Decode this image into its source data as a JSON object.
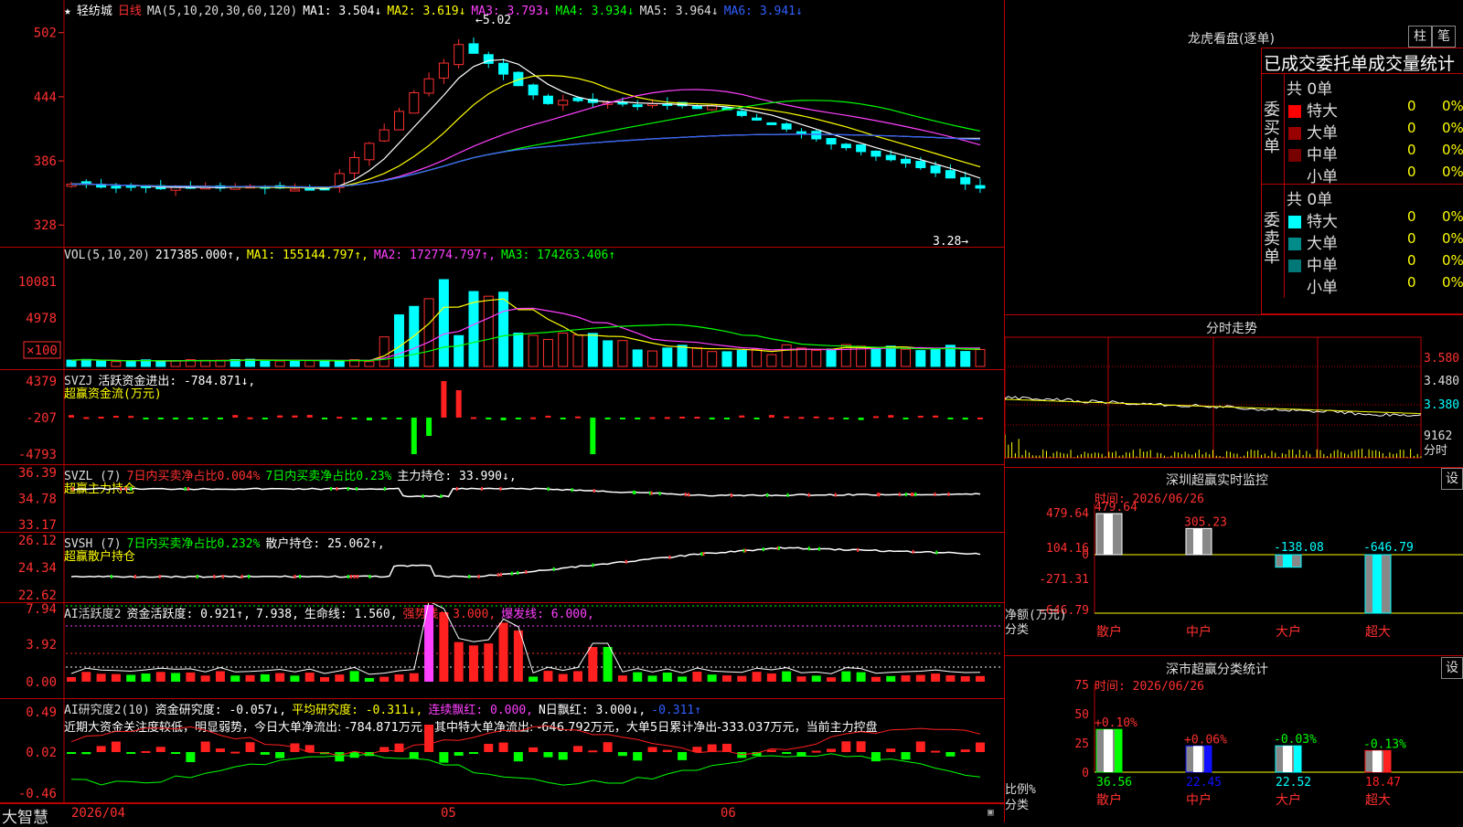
{
  "header": {
    "stock": "轻纺城",
    "period": "日线",
    "ma_label": "MA(5,10,20,30,60,120)",
    "ma": [
      {
        "label": "MA1:",
        "value": "3.504",
        "arrow": "↓",
        "color": "#ffffff"
      },
      {
        "label": "MA2:",
        "value": "3.619",
        "arrow": "↓",
        "color": "#ffff00"
      },
      {
        "label": "MA3:",
        "value": "3.793",
        "arrow": "↓",
        "color": "#ff40ff"
      },
      {
        "label": "MA4:",
        "value": "3.934",
        "arrow": "↓",
        "color": "#00ff00"
      },
      {
        "label": "MA5:",
        "value": "3.964",
        "arrow": "↓",
        "color": "#dddddd"
      },
      {
        "label": "MA6:",
        "value": "3.941",
        "arrow": "↓",
        "color": "#3060ff"
      }
    ]
  },
  "price_axis": [
    "502",
    "444",
    "386",
    "328"
  ],
  "price_high_label": "5.02",
  "price_low_label": "3.28",
  "vol": {
    "header": [
      {
        "t": "VOL(5,10,20)",
        "c": "#dddddd"
      },
      {
        "t": "217385.000↑,",
        "c": "#ffffff"
      },
      {
        "t": "MA1: 155144.797↑,",
        "c": "#ffff00"
      },
      {
        "t": "MA2: 172774.797↑,",
        "c": "#ff40ff"
      },
      {
        "t": "MA3: 174263.406↑",
        "c": "#00ff00"
      }
    ],
    "axis": [
      "10081",
      "4978"
    ],
    "unit": "×100"
  },
  "svzj": {
    "header": [
      {
        "t": "SVZJ",
        "c": "#dddddd"
      },
      {
        "t": "活跃资金进出: -784.871↓,",
        "c": "#ffffff"
      }
    ],
    "sub": "超赢资金流(万元)",
    "axis": [
      "4379",
      "-207",
      "-4793"
    ]
  },
  "svzl": {
    "header": [
      {
        "t": "SVZL (7)",
        "c": "#dddddd"
      },
      {
        "t": "7日内买卖净占比0.004%",
        "c": "#ff3030"
      },
      {
        "t": "7日内买卖净占比0.23%",
        "c": "#00ff00"
      },
      {
        "t": "主力持仓: 33.990↓,",
        "c": "#ffffff"
      }
    ],
    "sub": "超赢主力持仓",
    "axis": [
      "36.39",
      "34.78",
      "33.17"
    ]
  },
  "svsh": {
    "header": [
      {
        "t": "SVSH (7)",
        "c": "#dddddd"
      },
      {
        "t": "7日内买卖净占比0.232%",
        "c": "#00ff00"
      },
      {
        "t": "散户持仓: 25.062↑,",
        "c": "#ffffff"
      }
    ],
    "sub": "超赢散户持仓",
    "axis": [
      "26.12",
      "24.34",
      "22.62"
    ]
  },
  "ai1": {
    "header": [
      {
        "t": "AI活跃度2",
        "c": "#dddddd"
      },
      {
        "t": "资金活跃度: 0.921↑,",
        "c": "#ffffff"
      },
      {
        "t": "7.938,",
        "c": "#ffffff"
      },
      {
        "t": "生命线: 1.560,",
        "c": "#ffffff"
      },
      {
        "t": "强势线: 3.000,",
        "c": "#ff3030"
      },
      {
        "t": "爆发线: 6.000,",
        "c": "#ff40ff"
      }
    ],
    "axis": [
      "7.94",
      "3.92",
      "0.00"
    ]
  },
  "ai2": {
    "header": [
      {
        "t": "AI研究度2(10)",
        "c": "#dddddd"
      },
      {
        "t": "资金研究度: -0.057↓,",
        "c": "#ffffff"
      },
      {
        "t": "平均研究度: -0.311↓,",
        "c": "#ffff00"
      },
      {
        "t": "连续飘红: 0.000,",
        "c": "#ff40ff"
      },
      {
        "t": "N日飘红: 3.000↓,",
        "c": "#ffffff"
      },
      {
        "t": "-0.311↑",
        "c": "#3060ff"
      }
    ],
    "text": "近期大资金关注度较低，明显弱势，今日大单净流出: -784.871万元，其中特大单净流出: -646.792万元，大单5日累计净出-333.037万元，当前主力控盘",
    "axis": [
      "0.49",
      "0.02",
      "-0.46"
    ]
  },
  "bottom": {
    "brand": "大智慧",
    "date1": "2026/04",
    "date2": "05",
    "date3": "06"
  },
  "lhb": {
    "title": "龙虎看盘(逐单)",
    "btn1": "柱",
    "btn2": "笔",
    "subtitle": "已成交委托单成交量统计",
    "buy_label": "委买单",
    "sell_label": "委卖单",
    "buy_total": "共 0单",
    "sell_total": "共 0单",
    "buy_rows": [
      {
        "name": "特大",
        "n": "0",
        "p": "0%",
        "color": "#ff0000"
      },
      {
        "name": "大单",
        "n": "0",
        "p": "0%",
        "color": "#990000"
      },
      {
        "name": "中单",
        "n": "0",
        "p": "0%",
        "color": "#770000"
      },
      {
        "name": "小单",
        "n": "0",
        "p": "0%",
        "color": "#000000"
      }
    ],
    "sell_rows": [
      {
        "name": "特大",
        "n": "0",
        "p": "0%",
        "color": "#00ffff"
      },
      {
        "name": "大单",
        "n": "0",
        "p": "0%",
        "color": "#008b8b"
      },
      {
        "name": "中单",
        "n": "0",
        "p": "0%",
        "color": "#007878"
      },
      {
        "name": "小单",
        "n": "0",
        "p": "0%",
        "color": "#000000"
      }
    ]
  },
  "fenshi": {
    "title": "分时走势",
    "axis": [
      "3.580",
      "3.480",
      "3.380"
    ],
    "vol_label": "9162",
    "unit": "分时"
  },
  "monitor": {
    "title": "深圳超赢实时监控",
    "btn": "设",
    "time_label": "时间: 2026/06/26",
    "axis": [
      "479.64",
      "104.16",
      "0",
      "-271.31",
      "-646.79"
    ],
    "ylabel": "净额(万元)",
    "xlabel": "分类",
    "bars": [
      {
        "name": "散户",
        "value": "479.64"
      },
      {
        "name": "中户",
        "value": "305.23"
      },
      {
        "name": "大户",
        "value": "-138.08"
      },
      {
        "name": "超大",
        "value": "-646.79"
      }
    ]
  },
  "cls": {
    "title": "深市超赢分类统计",
    "btn": "设",
    "time_label": "时间: 2026/06/26",
    "axis": [
      "75",
      "50",
      "25",
      "0"
    ],
    "ylabel": "比例%",
    "xlabel": "分类",
    "bars": [
      {
        "name": "散户",
        "pct": "+0.10%",
        "value": "36.56",
        "color": "#00ff00"
      },
      {
        "name": "中户",
        "pct": "+0.06%",
        "value": "22.45",
        "color": "#1010ff"
      },
      {
        "name": "大户",
        "pct": "-0.03%",
        "value": "22.52",
        "color": "#00ffff"
      },
      {
        "name": "超大",
        "pct": "-0.13%",
        "value": "18.47",
        "color": "#ff2020"
      }
    ]
  }
}
